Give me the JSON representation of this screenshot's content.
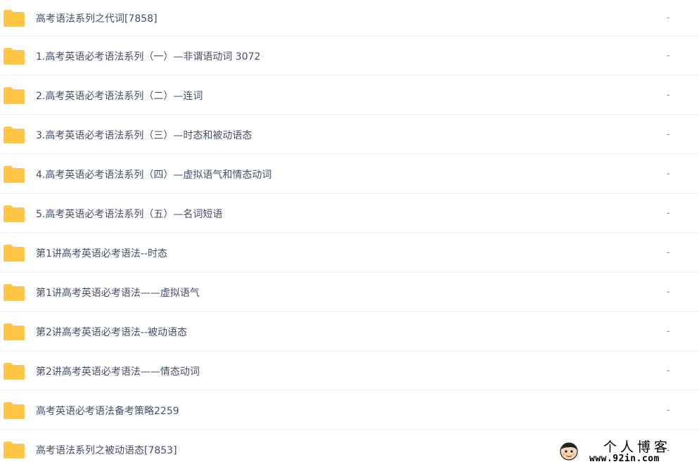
{
  "folder_color": "#ffc544",
  "folder_icon": "folder-icon",
  "rows": [
    {
      "name": "高考语法系列之代词[7858]",
      "size": "-"
    },
    {
      "name": "1.高考英语必考语法系列（一）—非谓语动词 3072",
      "size": "-"
    },
    {
      "name": "2.高考英语必考语法系列（二）—连词",
      "size": "-"
    },
    {
      "name": "3.高考英语必考语法系列（三）—时态和被动语态",
      "size": "-"
    },
    {
      "name": "4.高考英语必考语法系列（四）—虚拟语气和情态动词",
      "size": "-"
    },
    {
      "name": "5.高考英语必考语法系列（五）—名词短语",
      "size": "-"
    },
    {
      "name": "第1讲高考英语必考语法--时态",
      "size": "-"
    },
    {
      "name": "第1讲高考英语必考语法——虚拟语气",
      "size": "-"
    },
    {
      "name": "第2讲高考英语必考语法--被动语态",
      "size": "-"
    },
    {
      "name": "第2讲高考英语必考语法——情态动词",
      "size": "-"
    },
    {
      "name": "高考英语必考语法备考策略2259",
      "size": "-"
    },
    {
      "name": "高考语法系列之被动语态[7853]",
      "size": "-"
    }
  ],
  "watermark": {
    "title": "个人博客",
    "url": "www.92in.com"
  }
}
